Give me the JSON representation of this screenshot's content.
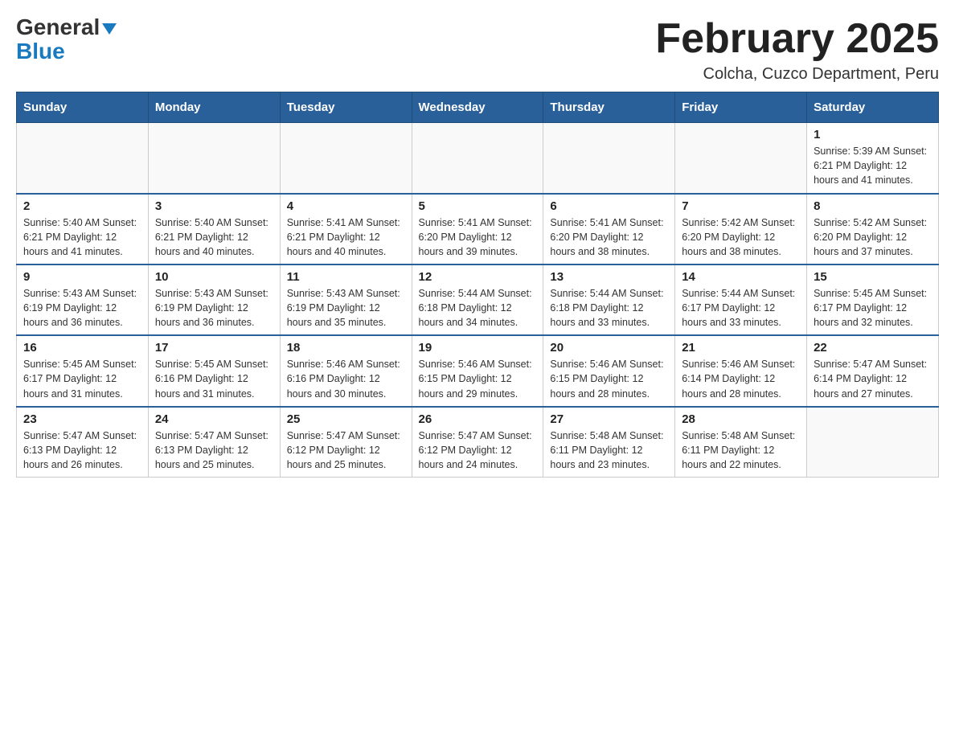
{
  "header": {
    "logo_line1": "General",
    "logo_line2": "Blue",
    "month_title": "February 2025",
    "subtitle": "Colcha, Cuzco Department, Peru"
  },
  "days_of_week": [
    "Sunday",
    "Monday",
    "Tuesday",
    "Wednesday",
    "Thursday",
    "Friday",
    "Saturday"
  ],
  "weeks": [
    [
      {
        "day": "",
        "info": ""
      },
      {
        "day": "",
        "info": ""
      },
      {
        "day": "",
        "info": ""
      },
      {
        "day": "",
        "info": ""
      },
      {
        "day": "",
        "info": ""
      },
      {
        "day": "",
        "info": ""
      },
      {
        "day": "1",
        "info": "Sunrise: 5:39 AM\nSunset: 6:21 PM\nDaylight: 12 hours and 41 minutes."
      }
    ],
    [
      {
        "day": "2",
        "info": "Sunrise: 5:40 AM\nSunset: 6:21 PM\nDaylight: 12 hours and 41 minutes."
      },
      {
        "day": "3",
        "info": "Sunrise: 5:40 AM\nSunset: 6:21 PM\nDaylight: 12 hours and 40 minutes."
      },
      {
        "day": "4",
        "info": "Sunrise: 5:41 AM\nSunset: 6:21 PM\nDaylight: 12 hours and 40 minutes."
      },
      {
        "day": "5",
        "info": "Sunrise: 5:41 AM\nSunset: 6:20 PM\nDaylight: 12 hours and 39 minutes."
      },
      {
        "day": "6",
        "info": "Sunrise: 5:41 AM\nSunset: 6:20 PM\nDaylight: 12 hours and 38 minutes."
      },
      {
        "day": "7",
        "info": "Sunrise: 5:42 AM\nSunset: 6:20 PM\nDaylight: 12 hours and 38 minutes."
      },
      {
        "day": "8",
        "info": "Sunrise: 5:42 AM\nSunset: 6:20 PM\nDaylight: 12 hours and 37 minutes."
      }
    ],
    [
      {
        "day": "9",
        "info": "Sunrise: 5:43 AM\nSunset: 6:19 PM\nDaylight: 12 hours and 36 minutes."
      },
      {
        "day": "10",
        "info": "Sunrise: 5:43 AM\nSunset: 6:19 PM\nDaylight: 12 hours and 36 minutes."
      },
      {
        "day": "11",
        "info": "Sunrise: 5:43 AM\nSunset: 6:19 PM\nDaylight: 12 hours and 35 minutes."
      },
      {
        "day": "12",
        "info": "Sunrise: 5:44 AM\nSunset: 6:18 PM\nDaylight: 12 hours and 34 minutes."
      },
      {
        "day": "13",
        "info": "Sunrise: 5:44 AM\nSunset: 6:18 PM\nDaylight: 12 hours and 33 minutes."
      },
      {
        "day": "14",
        "info": "Sunrise: 5:44 AM\nSunset: 6:17 PM\nDaylight: 12 hours and 33 minutes."
      },
      {
        "day": "15",
        "info": "Sunrise: 5:45 AM\nSunset: 6:17 PM\nDaylight: 12 hours and 32 minutes."
      }
    ],
    [
      {
        "day": "16",
        "info": "Sunrise: 5:45 AM\nSunset: 6:17 PM\nDaylight: 12 hours and 31 minutes."
      },
      {
        "day": "17",
        "info": "Sunrise: 5:45 AM\nSunset: 6:16 PM\nDaylight: 12 hours and 31 minutes."
      },
      {
        "day": "18",
        "info": "Sunrise: 5:46 AM\nSunset: 6:16 PM\nDaylight: 12 hours and 30 minutes."
      },
      {
        "day": "19",
        "info": "Sunrise: 5:46 AM\nSunset: 6:15 PM\nDaylight: 12 hours and 29 minutes."
      },
      {
        "day": "20",
        "info": "Sunrise: 5:46 AM\nSunset: 6:15 PM\nDaylight: 12 hours and 28 minutes."
      },
      {
        "day": "21",
        "info": "Sunrise: 5:46 AM\nSunset: 6:14 PM\nDaylight: 12 hours and 28 minutes."
      },
      {
        "day": "22",
        "info": "Sunrise: 5:47 AM\nSunset: 6:14 PM\nDaylight: 12 hours and 27 minutes."
      }
    ],
    [
      {
        "day": "23",
        "info": "Sunrise: 5:47 AM\nSunset: 6:13 PM\nDaylight: 12 hours and 26 minutes."
      },
      {
        "day": "24",
        "info": "Sunrise: 5:47 AM\nSunset: 6:13 PM\nDaylight: 12 hours and 25 minutes."
      },
      {
        "day": "25",
        "info": "Sunrise: 5:47 AM\nSunset: 6:12 PM\nDaylight: 12 hours and 25 minutes."
      },
      {
        "day": "26",
        "info": "Sunrise: 5:47 AM\nSunset: 6:12 PM\nDaylight: 12 hours and 24 minutes."
      },
      {
        "day": "27",
        "info": "Sunrise: 5:48 AM\nSunset: 6:11 PM\nDaylight: 12 hours and 23 minutes."
      },
      {
        "day": "28",
        "info": "Sunrise: 5:48 AM\nSunset: 6:11 PM\nDaylight: 12 hours and 22 minutes."
      },
      {
        "day": "",
        "info": ""
      }
    ]
  ]
}
